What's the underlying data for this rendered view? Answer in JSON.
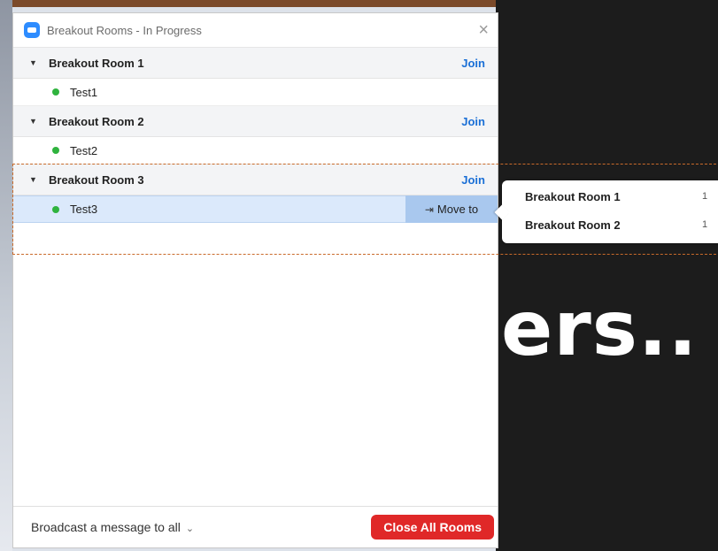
{
  "window": {
    "title": "Breakout Rooms - In Progress",
    "close_icon": "×"
  },
  "rooms": [
    {
      "name": "Breakout Room 1",
      "join_label": "Join",
      "members": [
        "Test1"
      ]
    },
    {
      "name": "Breakout Room 2",
      "join_label": "Join",
      "members": [
        "Test2"
      ]
    },
    {
      "name": "Breakout Room 3",
      "join_label": "Join",
      "members": [
        "Test3"
      ]
    }
  ],
  "selected_member": {
    "name": "Test3",
    "move_to_label": "Move to"
  },
  "move_menu": [
    {
      "room": "Breakout Room 1",
      "count": "1"
    },
    {
      "room": "Breakout Room 2",
      "count": "1"
    }
  ],
  "footer": {
    "broadcast_label": "Broadcast a message to all",
    "close_all_label": "Close All Rooms"
  },
  "background": {
    "watermark_text": "ers.."
  },
  "colors": {
    "accent": "#1a6fd6",
    "danger": "#e02828",
    "online": "#2fb33e",
    "selection": "#dbe9fb"
  }
}
